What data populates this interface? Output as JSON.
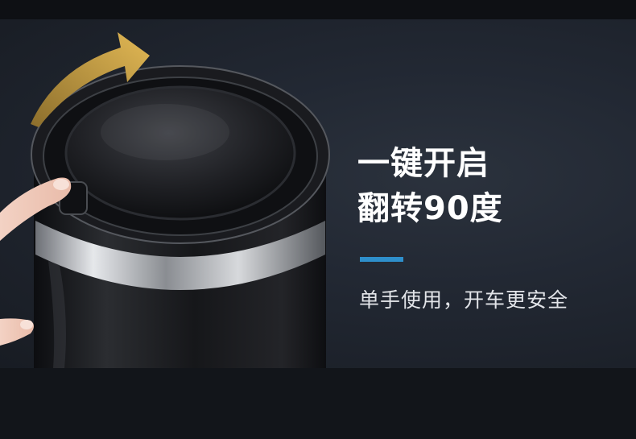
{
  "headline": {
    "line1": "一键开启",
    "line2": "翻转90度"
  },
  "subheadline": "单手使用，开车更安全",
  "colors": {
    "accent_bar": "#2e8fcb",
    "arrow": "#c9a24b",
    "background": "#1e232b"
  }
}
